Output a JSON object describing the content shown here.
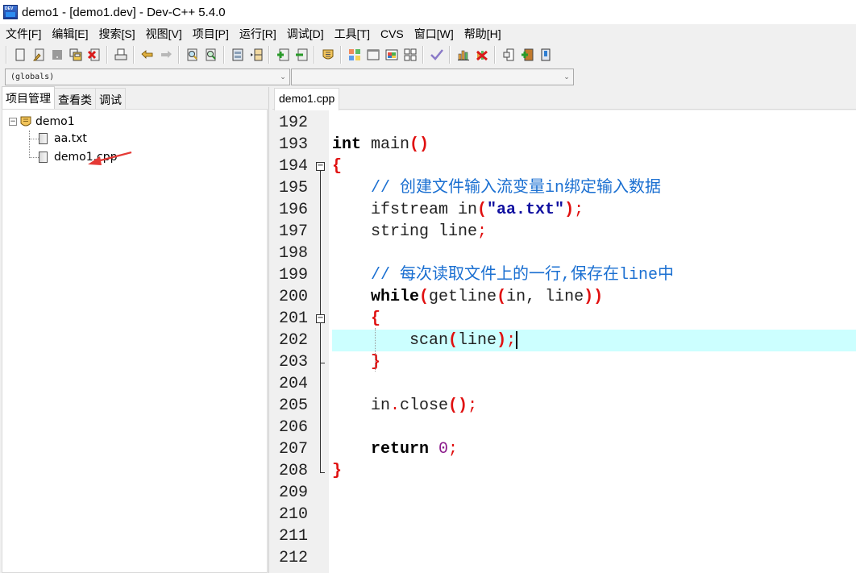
{
  "window": {
    "title": "demo1 - [demo1.dev] - Dev-C++ 5.4.0"
  },
  "menu": [
    {
      "label": "文件[F]"
    },
    {
      "label": "编辑[E]"
    },
    {
      "label": "搜索[S]"
    },
    {
      "label": "视图[V]"
    },
    {
      "label": "项目[P]"
    },
    {
      "label": "运行[R]"
    },
    {
      "label": "调试[D]"
    },
    {
      "label": "工具[T]"
    },
    {
      "label": "CVS"
    },
    {
      "label": "窗口[W]"
    },
    {
      "label": "帮助[H]"
    }
  ],
  "toolbar": {
    "buttons": [
      {
        "icon": "new-file-icon"
      },
      {
        "icon": "open-file-icon"
      },
      {
        "icon": "save-icon"
      },
      {
        "icon": "save-all-icon"
      },
      {
        "icon": "close-file-icon"
      },
      {
        "icon": "print-icon"
      },
      {
        "icon": "undo-icon"
      },
      {
        "icon": "redo-icon"
      },
      {
        "icon": "find-icon"
      },
      {
        "icon": "replace-icon"
      },
      {
        "icon": "unindent-icon"
      },
      {
        "icon": "indent-icon"
      },
      {
        "icon": "add-to-project-icon"
      },
      {
        "icon": "remove-from-project-icon"
      },
      {
        "icon": "project-options-icon"
      },
      {
        "icon": "compile-icon"
      },
      {
        "icon": "run-icon"
      },
      {
        "icon": "compile-run-icon"
      },
      {
        "icon": "rebuild-icon"
      },
      {
        "icon": "syntax-check-icon"
      },
      {
        "icon": "profile-icon"
      },
      {
        "icon": "delete-profile-icon"
      },
      {
        "icon": "goto-icon"
      },
      {
        "icon": "new-class-icon"
      },
      {
        "icon": "about-icon"
      }
    ]
  },
  "combos": {
    "scope": {
      "value": "(globals)"
    },
    "symbol": {
      "value": ""
    }
  },
  "left_panel": {
    "tabs": [
      {
        "label": "项目管理",
        "active": true
      },
      {
        "label": "查看类",
        "active": false
      },
      {
        "label": "调试",
        "active": false
      }
    ],
    "tree": {
      "project": "demo1",
      "toggle": "−",
      "files": [
        {
          "name": "aa.txt"
        },
        {
          "name": "demo1.cpp"
        }
      ]
    }
  },
  "editor": {
    "tab": "demo1.cpp",
    "current_line": 202,
    "line_numbers": [
      "192",
      "193",
      "194",
      "195",
      "196",
      "197",
      "198",
      "199",
      "200",
      "201",
      "202",
      "203",
      "204",
      "205",
      "206",
      "207",
      "208",
      "209",
      "210",
      "211",
      "212"
    ],
    "code": {
      "l193_kw": "int",
      "l193_fn": " main",
      "l193_op": "()",
      "l194": "{",
      "l195": "    // 创建文件输入流变量in绑定输入数据",
      "l196_a": "    ifstream in",
      "l196_op1": "(",
      "l196_str": "\"aa.txt\"",
      "l196_op2": ")",
      "l196_semi": ";",
      "l197_a": "    string line",
      "l197_semi": ";",
      "l199": "    // 每次读取文件上的一行,保存在line中",
      "l200_indent": "    ",
      "l200_kw": "while",
      "l200_op1": "(",
      "l200_a": "getline",
      "l200_op2": "(",
      "l200_b": "in, line",
      "l200_op3": "))",
      "l201_indent": "    ",
      "l201": "{",
      "l202_indent": "        ",
      "l202_a": "scan",
      "l202_op1": "(",
      "l202_b": "line",
      "l202_op2": ")",
      "l202_semi": ";",
      "l203_indent": "    ",
      "l203": "}",
      "l205_a": "    in",
      "l205_dot": ".",
      "l205_b": "close",
      "l205_op": "()",
      "l205_semi": ";",
      "l207_indent": "    ",
      "l207_kw": "return",
      "l207_num": " 0",
      "l207_semi": ";",
      "l208": "}"
    }
  },
  "colors": {
    "active_line": "#ccffff",
    "keyword": "#000000",
    "operator": "#e01010",
    "string": "#1010a0",
    "comment": "#1a6fd1",
    "number": "#8b1a8b",
    "annotation_arrow": "#e53935"
  }
}
